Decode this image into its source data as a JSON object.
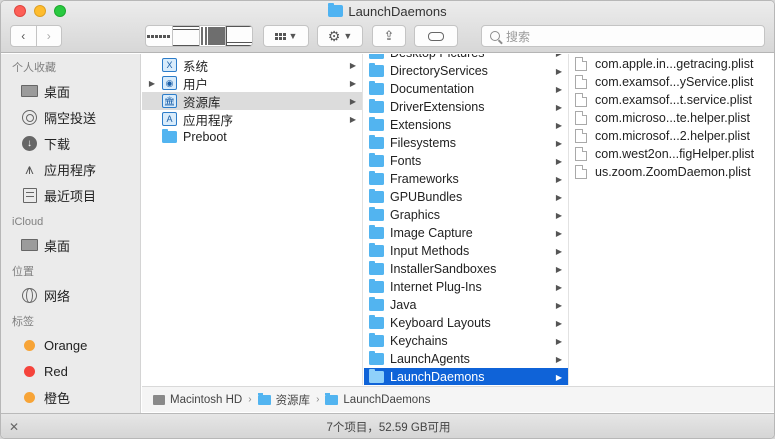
{
  "window": {
    "title": "LaunchDaemons"
  },
  "toolbar": {
    "back_icon": "‹",
    "forward_icon": "›",
    "search_placeholder": "搜索"
  },
  "sidebar": {
    "sections": [
      {
        "header": "个人收藏",
        "items": [
          {
            "label": "桌面",
            "icon": "desktop-icon"
          },
          {
            "label": "隔空投送",
            "icon": "airdrop-icon"
          },
          {
            "label": "下载",
            "icon": "download-icon"
          },
          {
            "label": "应用程序",
            "icon": "applications-icon"
          },
          {
            "label": "最近项目",
            "icon": "recents-icon"
          }
        ]
      },
      {
        "header": "iCloud",
        "items": [
          {
            "label": "桌面",
            "icon": "desktop-icon"
          }
        ]
      },
      {
        "header": "位置",
        "items": [
          {
            "label": "网络",
            "icon": "network-icon"
          }
        ]
      },
      {
        "header": "标签",
        "items": [
          {
            "label": "Orange",
            "color": "#f7a437"
          },
          {
            "label": "Red",
            "color": "#f5443c"
          },
          {
            "label": "橙色",
            "color": "#f7a437"
          }
        ]
      }
    ]
  },
  "column1": [
    {
      "label": "系统",
      "badge": "X"
    },
    {
      "label": "用户",
      "badge": "◉"
    },
    {
      "label": "资源库",
      "badge": "🏛"
    },
    {
      "label": "应用程序",
      "badge": "A"
    },
    {
      "label": "Preboot"
    }
  ],
  "column2": [
    "Desktop Pictures",
    "DirectoryServices",
    "Documentation",
    "DriverExtensions",
    "Extensions",
    "Filesystems",
    "Fonts",
    "Frameworks",
    "GPUBundles",
    "Graphics",
    "Image Capture",
    "Input Methods",
    "InstallerSandboxes",
    "Internet Plug-Ins",
    "Java",
    "Keyboard Layouts",
    "Keychains",
    "LaunchAgents",
    "LaunchDaemons"
  ],
  "column3": [
    "com.apple.in...getracing.plist",
    "com.examsof...yService.plist",
    "com.examsof...t.service.plist",
    "com.microso...te.helper.plist",
    "com.microsof...2.helper.plist",
    "com.west2on...figHelper.plist",
    "us.zoom.ZoomDaemon.plist"
  ],
  "pathbar": [
    "Macintosh HD",
    "资源库",
    "LaunchDaemons"
  ],
  "status": {
    "text": "7个项目，52.59 GB可用"
  }
}
